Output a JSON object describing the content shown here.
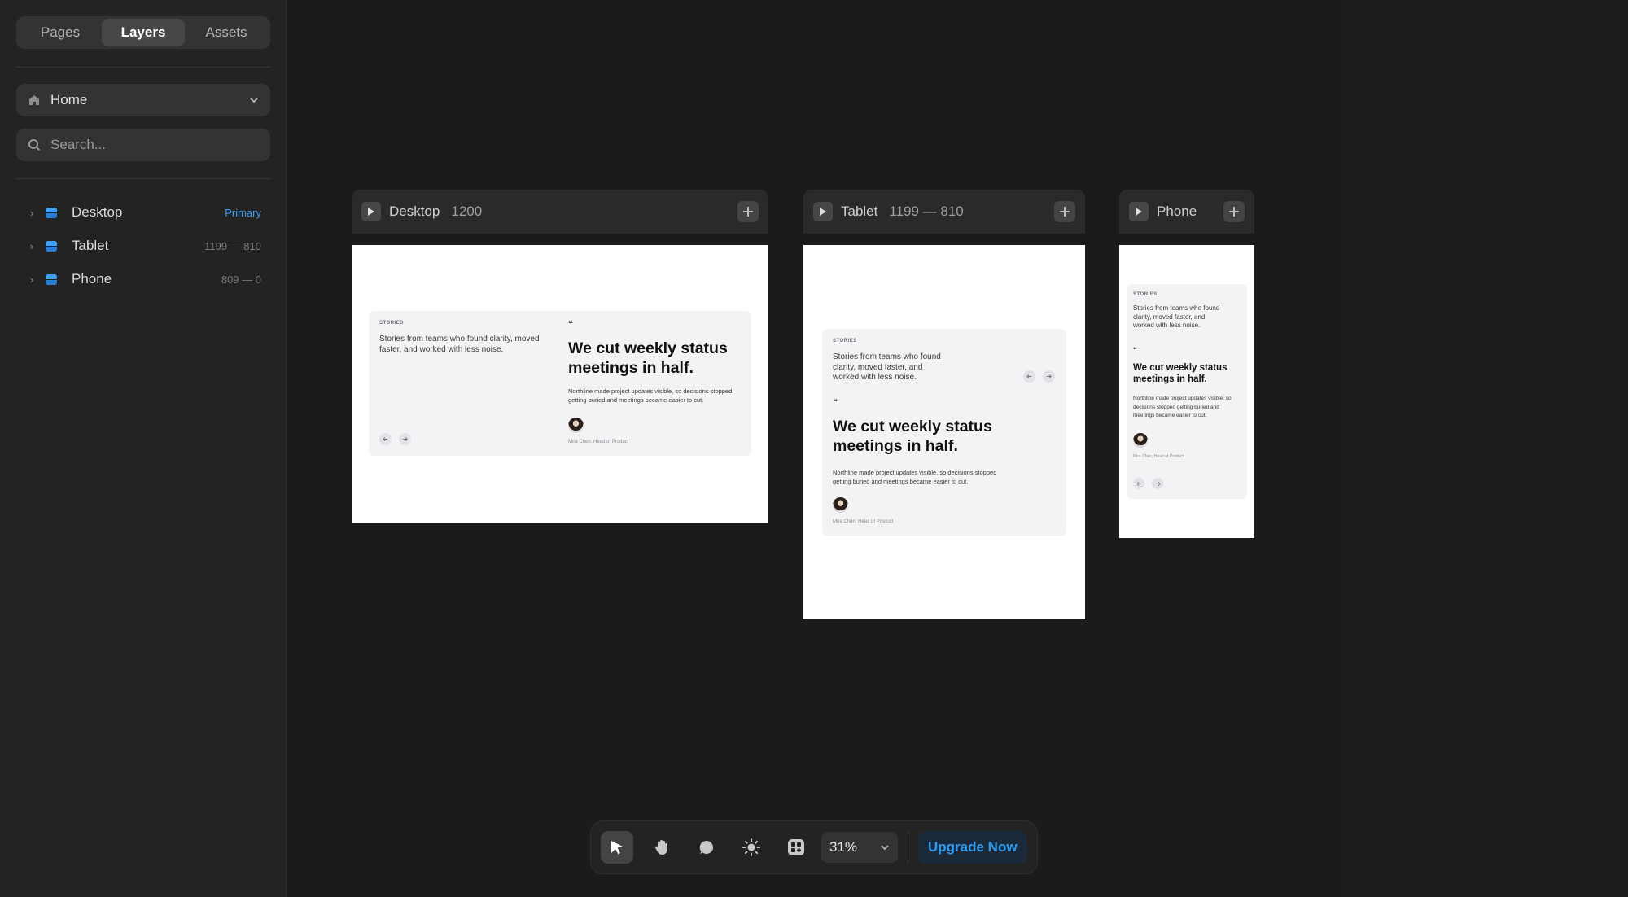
{
  "sidebar": {
    "tabs": [
      {
        "label": "Pages"
      },
      {
        "label": "Layers"
      },
      {
        "label": "Assets"
      }
    ],
    "active_tab": "Layers",
    "page_select": {
      "label": "Home"
    },
    "search": {
      "placeholder": "Search..."
    },
    "layers": [
      {
        "name": "Desktop",
        "meta": "Primary"
      },
      {
        "name": "Tablet",
        "meta": "1199 — 810"
      },
      {
        "name": "Phone",
        "meta": "809 — 0"
      }
    ]
  },
  "frames": {
    "desktop": {
      "name": "Desktop",
      "size": "1200"
    },
    "tablet": {
      "name": "Tablet",
      "size": "1199 — 810"
    },
    "phone": {
      "name": "Phone",
      "size": ""
    }
  },
  "content": {
    "kicker": "STORIES",
    "intro": "Stories from teams who found clarity, moved faster, and worked with less noise.",
    "quote_mark": "❝",
    "headline": "We cut weekly status meetings in half.",
    "body": "Northline made project updates visible, so decisions stopped getting buried and meetings became easier to cut.",
    "byline": "Mira Chen, Head of Product"
  },
  "toolbar": {
    "zoom": "31%",
    "upgrade_label": "Upgrade Now"
  },
  "colors": {
    "accent": "#2f9bf0",
    "sidebar_bg": "#232323",
    "canvas_bg": "#1b1b1b"
  }
}
